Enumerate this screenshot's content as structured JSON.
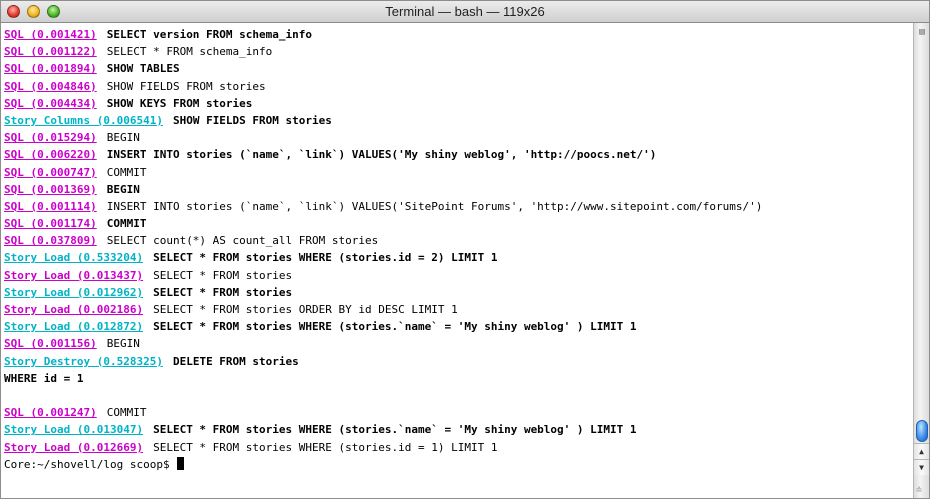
{
  "window": {
    "title": "Terminal — bash — 119x26"
  },
  "log_lines": [
    {
      "tag": "SQL (0.001421)",
      "kind": "sql",
      "text": "SELECT version FROM schema_info",
      "bold": true
    },
    {
      "tag": "SQL (0.001122)",
      "kind": "sql",
      "text": "SELECT * FROM schema_info",
      "bold": false
    },
    {
      "tag": "SQL (0.001894)",
      "kind": "sql",
      "text": "SHOW TABLES",
      "bold": true
    },
    {
      "tag": "SQL (0.004846)",
      "kind": "sql",
      "text": "SHOW FIELDS FROM stories",
      "bold": false
    },
    {
      "tag": "SQL (0.004434)",
      "kind": "sql",
      "text": "SHOW KEYS FROM stories",
      "bold": true
    },
    {
      "tag": "Story Columns (0.006541)",
      "kind": "model",
      "text": "SHOW FIELDS FROM stories",
      "bold": true
    },
    {
      "tag": "SQL (0.015294)",
      "kind": "sql",
      "text": "BEGIN",
      "bold": false
    },
    {
      "tag": "SQL (0.006220)",
      "kind": "sql",
      "text": "INSERT INTO stories (`name`, `link`) VALUES('My shiny weblog', 'http://poocs.net/')",
      "bold": true
    },
    {
      "tag": "SQL (0.000747)",
      "kind": "sql",
      "text": "COMMIT",
      "bold": false
    },
    {
      "tag": "SQL (0.001369)",
      "kind": "sql",
      "text": "BEGIN",
      "bold": true
    },
    {
      "tag": "SQL (0.001114)",
      "kind": "sql",
      "text": "INSERT INTO stories (`name`, `link`) VALUES('SitePoint Forums', 'http://www.sitepoint.com/forums/')",
      "bold": false
    },
    {
      "tag": "SQL (0.001174)",
      "kind": "sql",
      "text": "COMMIT",
      "bold": true
    },
    {
      "tag": "SQL (0.037809)",
      "kind": "sql",
      "text": "SELECT count(*) AS count_all FROM stories",
      "bold": false
    },
    {
      "tag": "Story Load (0.533204)",
      "kind": "model",
      "text": "SELECT * FROM stories WHERE (stories.id = 2) LIMIT 1",
      "bold": true
    },
    {
      "tag": "Story Load (0.013437)",
      "kind": "sql",
      "text": "SELECT * FROM stories",
      "bold": false
    },
    {
      "tag": "Story Load (0.012962)",
      "kind": "model",
      "text": "SELECT * FROM stories",
      "bold": true
    },
    {
      "tag": "Story Load (0.002186)",
      "kind": "sql",
      "text": "SELECT * FROM stories ORDER BY id DESC LIMIT 1",
      "bold": false
    },
    {
      "tag": "Story Load (0.012872)",
      "kind": "model",
      "text": "SELECT * FROM stories WHERE (stories.`name` = 'My shiny weblog' ) LIMIT 1",
      "bold": true
    },
    {
      "tag": "SQL (0.001156)",
      "kind": "sql",
      "text": "BEGIN",
      "bold": false
    },
    {
      "tag": "Story Destroy (0.528325)",
      "kind": "model",
      "text": "DELETE FROM stories",
      "bold": true
    }
  ],
  "wrapped_line": "WHERE id = 1",
  "tail_lines": [
    {
      "tag": "SQL (0.001247)",
      "kind": "sql",
      "text": "COMMIT",
      "bold": false
    },
    {
      "tag": "Story Load (0.013047)",
      "kind": "model",
      "text": "SELECT * FROM stories WHERE (stories.`name` = 'My shiny weblog' ) LIMIT 1",
      "bold": true
    },
    {
      "tag": "Story Load (0.012669)",
      "kind": "sql",
      "text": "SELECT * FROM stories WHERE (stories.id = 1) LIMIT 1",
      "bold": false
    }
  ],
  "prompt": "Core:~/shovell/log scoop$ ",
  "colors": {
    "sql": "#cc00cc",
    "model": "#00b3c7"
  }
}
